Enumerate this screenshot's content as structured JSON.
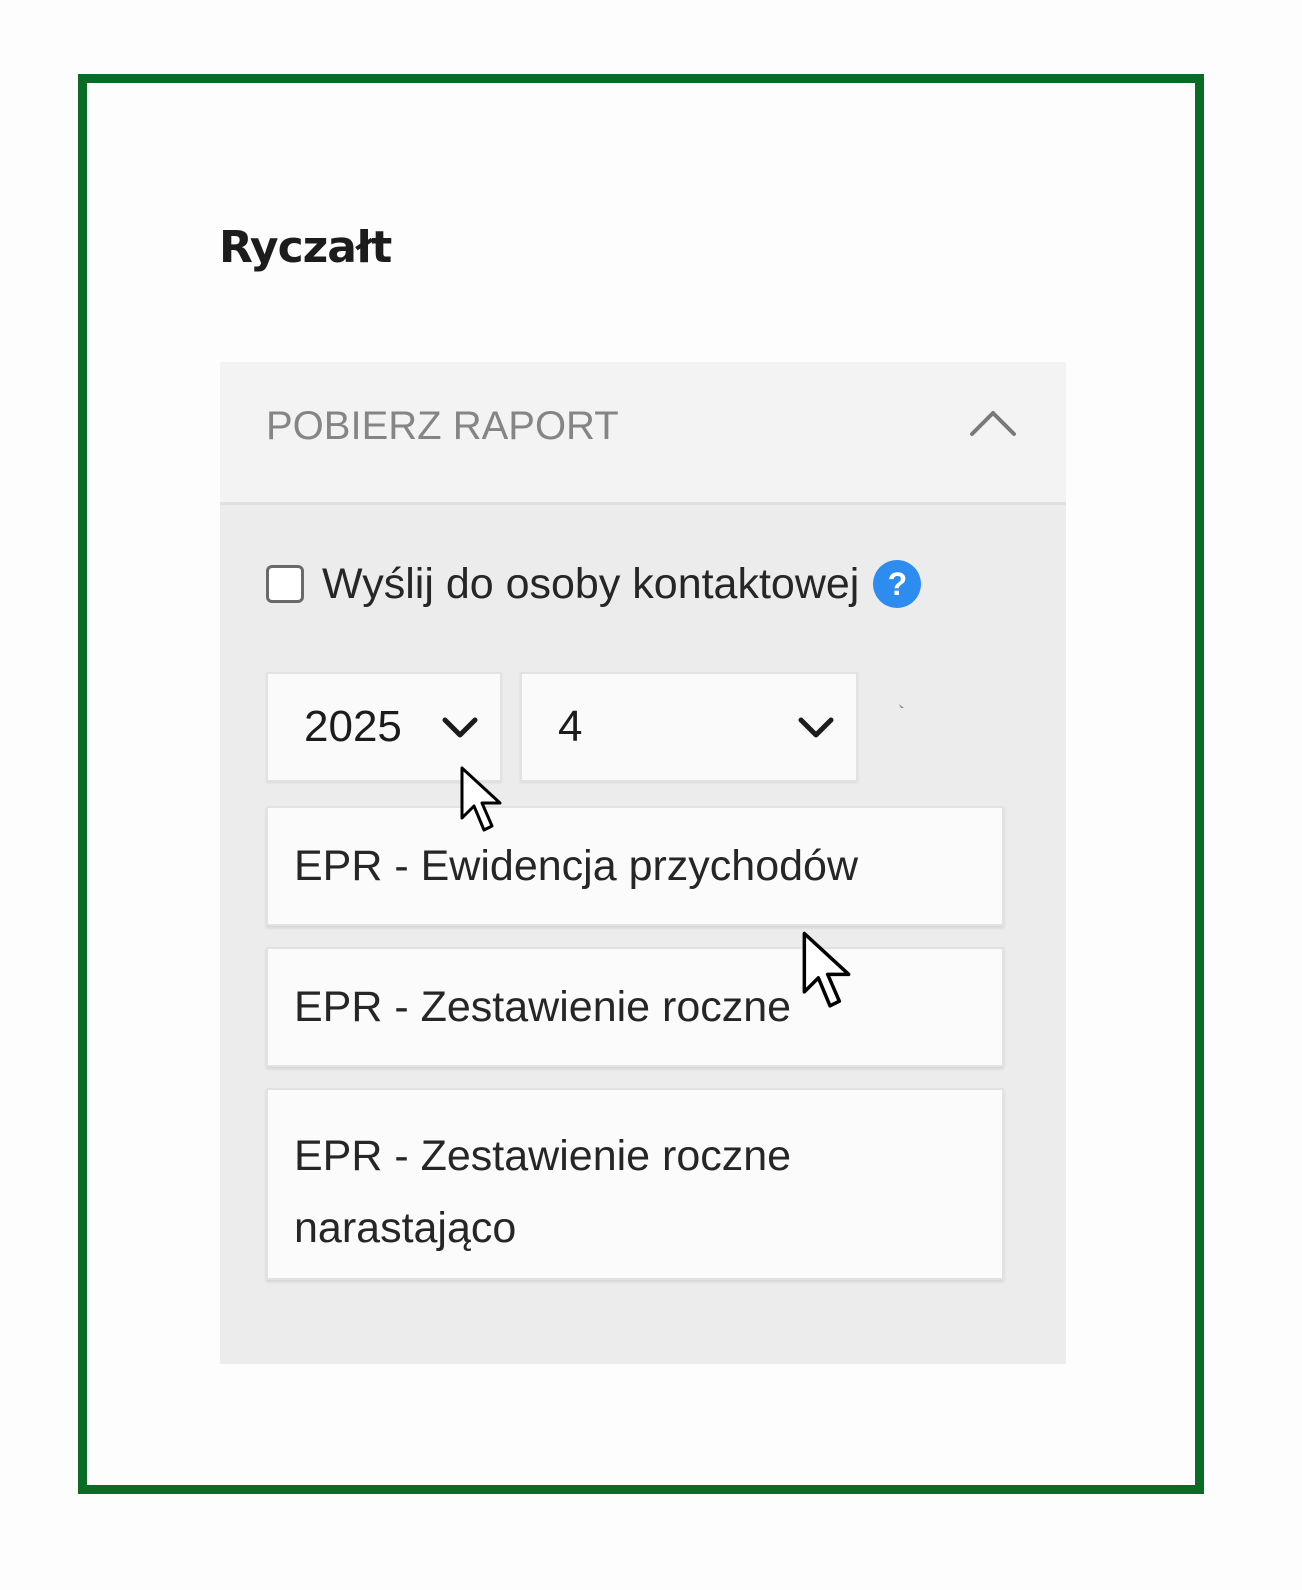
{
  "page": {
    "title": "Ryczałt"
  },
  "panel": {
    "header_label": "POBIERZ RAPORT",
    "header_icon": "chevron-up-icon",
    "send_checkbox": {
      "label": "Wyślij do osoby kontaktowej",
      "checked": false,
      "help_icon": "question-icon",
      "help_glyph": "?"
    },
    "year_select": {
      "value": "2025",
      "icon": "chevron-down-icon"
    },
    "month_select": {
      "value": "4",
      "icon": "chevron-down-icon"
    },
    "reports": [
      {
        "label": "EPR - Ewidencja przychodów"
      },
      {
        "label": "EPR - Zestawienie roczne"
      },
      {
        "label": "EPR - Zestawienie roczne narastająco"
      }
    ]
  },
  "colors": {
    "frame_border": "#0a6b26",
    "panel_bg": "#ececec",
    "help_icon": "#2d8cf0"
  }
}
